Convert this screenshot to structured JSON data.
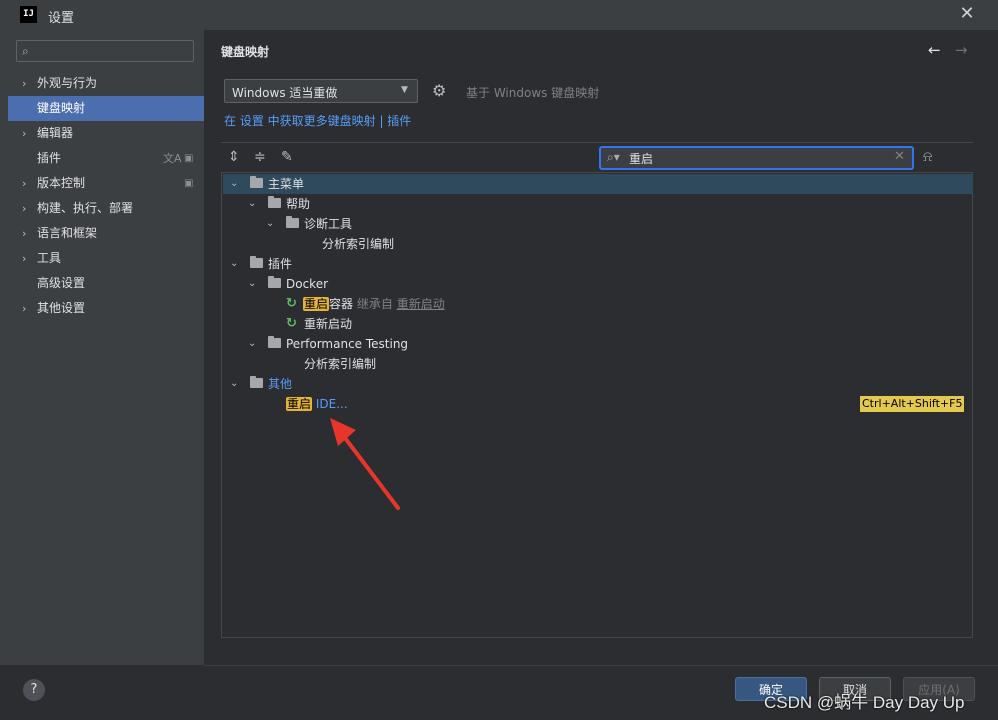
{
  "window": {
    "title": "设置",
    "logo": "IJ"
  },
  "sidebar": {
    "search_placeholder": "",
    "items": [
      {
        "label": "外观与行为",
        "expandable": true
      },
      {
        "label": "键盘映射",
        "expandable": false,
        "selected": true
      },
      {
        "label": "编辑器",
        "expandable": true
      },
      {
        "label": "插件",
        "expandable": false
      },
      {
        "label": "版本控制",
        "expandable": true
      },
      {
        "label": "构建、执行、部署",
        "expandable": true
      },
      {
        "label": "语言和框架",
        "expandable": true
      },
      {
        "label": "工具",
        "expandable": true
      },
      {
        "label": "高级设置",
        "expandable": false
      },
      {
        "label": "其他设置",
        "expandable": true
      }
    ]
  },
  "main": {
    "title": "键盘映射",
    "keymap_value": "Windows 适当重做",
    "based_on": "基于 Windows 键盘映射",
    "get_more_link": "在 设置 中获取更多键盘映射 | 插件",
    "search_value": "重启"
  },
  "tree": {
    "main_menu": "主菜单",
    "help": "帮助",
    "diag_tools": "诊断工具",
    "index_build": "分析索引编制",
    "plugins": "插件",
    "docker": "Docker",
    "hl_restart": "重启",
    "restart_container_suffix": "容器",
    "inherit_from": "继承自",
    "restart_start": "重新启动",
    "restart_start2": "重新启动",
    "perf_testing": "Performance Testing",
    "perf_index": "分析索引编制",
    "other": "其他",
    "restart_ide_suffix": "IDE...",
    "restart_ide_shortcut": "Ctrl+Alt+Shift+F5"
  },
  "buttons": {
    "ok": "确定",
    "cancel": "取消",
    "apply": "应用(A)",
    "help": "?"
  },
  "watermark": "CSDN @蜗牛 Day Day Up",
  "colors": {
    "accent": "#4b6eaf",
    "highlight": "#e5b43c",
    "link": "#589df6",
    "arrow": "#e8352c"
  }
}
